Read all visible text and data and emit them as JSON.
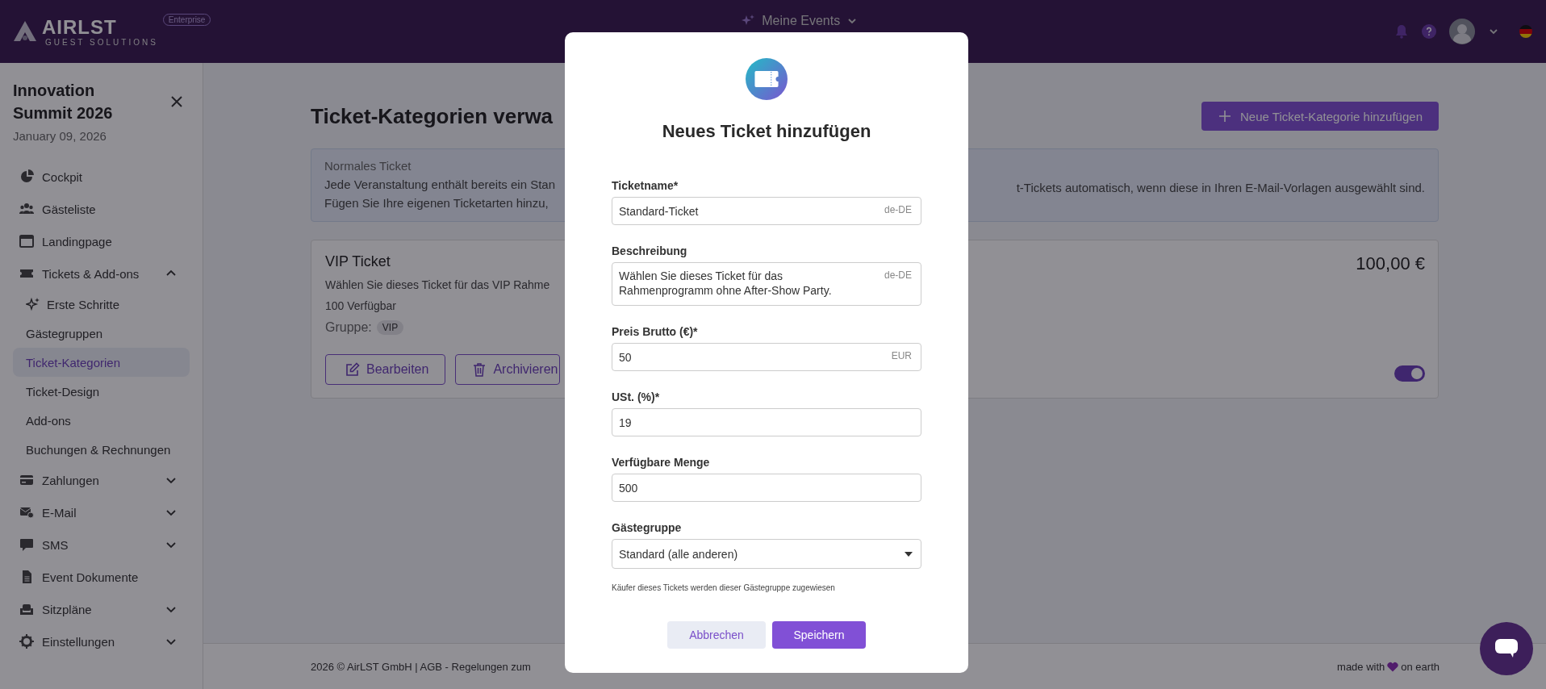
{
  "header": {
    "logo": {
      "wordmark": "AIRLST",
      "tagline": "GUEST SOLUTIONS",
      "badge": "Enterprise"
    },
    "events_menu": "Meine Events"
  },
  "sidebar": {
    "title": "Innovation Summit 2026",
    "date": "January 09, 2026",
    "items": [
      {
        "label": "Cockpit",
        "selected": false
      },
      {
        "label": "Gästeliste",
        "selected": false
      },
      {
        "label": "Landingpage",
        "selected": false
      },
      {
        "label": "Tickets & Add-ons",
        "selected": false,
        "expanded": true,
        "children": [
          {
            "label": "Erste Schritte",
            "kind": "icon",
            "selected": false
          },
          {
            "label": "Gästegruppen",
            "kind": "plain",
            "selected": false
          },
          {
            "label": "Ticket-Kategorien",
            "kind": "plain",
            "selected": true
          },
          {
            "label": "Ticket-Design",
            "kind": "plain",
            "selected": false
          },
          {
            "label": "Add-ons",
            "kind": "plain",
            "selected": false
          },
          {
            "label": "Buchungen & Rechnungen",
            "kind": "plain",
            "selected": false
          }
        ]
      },
      {
        "label": "Zahlungen",
        "selected": false,
        "expanded": false
      },
      {
        "label": "E-Mail",
        "selected": false,
        "expanded": false
      },
      {
        "label": "SMS",
        "selected": false,
        "expanded": false
      },
      {
        "label": "Event Dokumente",
        "selected": false
      },
      {
        "label": "Sitzpläne",
        "selected": false,
        "expanded": false
      },
      {
        "label": "Einstellungen",
        "selected": false,
        "expanded": false
      }
    ]
  },
  "page": {
    "title": "Ticket-Kategorien verwa",
    "add_button": "Neue Ticket-Kategorie hinzufügen",
    "info": {
      "heading": "Normales Ticket",
      "left_lines": [
        "Jede Veranstaltung enthält bereits ein Stan",
        "Fügen Sie Ihre eigenen Ticketarten hinzu,"
      ],
      "right_lines": [
        "t-Tickets automatisch, wenn diese in Ihren E-Mail-Vorlagen ausgewählt sind."
      ]
    },
    "card": {
      "name": "VIP Ticket",
      "description": "Wählen Sie dieses Ticket für das VIP Rahme",
      "availability": "100 Verfügbar",
      "group_label": "Gruppe:",
      "group_tag": "VIP",
      "edit_button": "Bearbeiten",
      "archive_button": "Archivieren",
      "price": "100,00 €",
      "active": true
    }
  },
  "footer": {
    "left": "2026 © AirLST GmbH | AGB - Regelungen zum",
    "right_before": "made with",
    "right_after": "on earth"
  },
  "modal": {
    "title": "Neues Ticket hinzufügen",
    "fields": [
      {
        "kind": "text",
        "label": "Ticketname*",
        "value": "Standard-Ticket",
        "suffix": "de-DE"
      },
      {
        "kind": "textarea",
        "label": "Beschreibung",
        "value": "Wählen Sie dieses Ticket für das Rahmenprogramm ohne After-Show Party.",
        "suffix": "de-DE"
      },
      {
        "kind": "text",
        "label": "Preis Brutto (€)*",
        "value": "50",
        "suffix": "EUR"
      },
      {
        "kind": "text",
        "label": "USt. (%)*",
        "value": "19"
      },
      {
        "kind": "text",
        "label": "Verfügbare Menge",
        "value": "500"
      },
      {
        "kind": "select",
        "label": "Gästegruppe",
        "value": "Standard (alle anderen)",
        "hint": "Käufer dieses Tickets werden dieser Gästegruppe zugewiesen"
      }
    ],
    "cancel_button": "Abbrechen",
    "save_button": "Speichern"
  }
}
